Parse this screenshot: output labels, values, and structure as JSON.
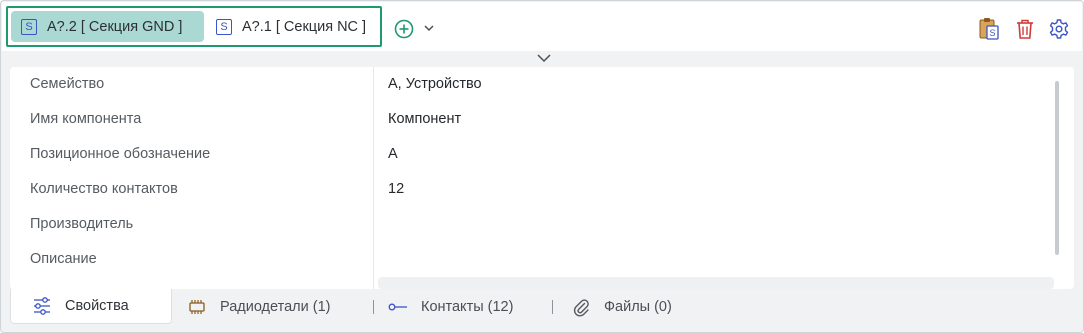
{
  "section_tabs": [
    {
      "badge": "S",
      "label": "A?.2 [ Секция GND ]",
      "active": true
    },
    {
      "badge": "S",
      "label": "A?.1 [ Секция NC ]",
      "active": false
    }
  ],
  "toolbar": {
    "add_icon": "plus-circle-icon",
    "add_menu_icon": "chevron-down-icon",
    "paste_icon": "clipboard-paste-icon",
    "delete_icon": "trash-icon",
    "settings_icon": "gear-icon"
  },
  "properties": [
    {
      "name": "Семейство",
      "value": "A, Устройство"
    },
    {
      "name": "Имя компонента",
      "value": "Компонент"
    },
    {
      "name": "Позиционное обозначение",
      "value": "A"
    },
    {
      "name": "Количество контактов",
      "value": "12"
    },
    {
      "name": "Производитель",
      "value": ""
    },
    {
      "name": "Описание",
      "value": ""
    }
  ],
  "bottom_tabs": [
    {
      "label": "Свойства",
      "icon": "sliders-icon",
      "active": true
    },
    {
      "label": "Радиодетали (1)",
      "icon": "chip-icon",
      "active": false
    },
    {
      "label": "Контакты (12)",
      "icon": "pin-icon",
      "active": false
    },
    {
      "label": "Файлы (0)",
      "icon": "paperclip-icon",
      "active": false
    }
  ],
  "colors": {
    "accent_green": "#1e9a6e",
    "active_tab_bg": "#aad8d2",
    "icon_blue": "#3b55c6",
    "delete_red": "#d13a3a"
  }
}
